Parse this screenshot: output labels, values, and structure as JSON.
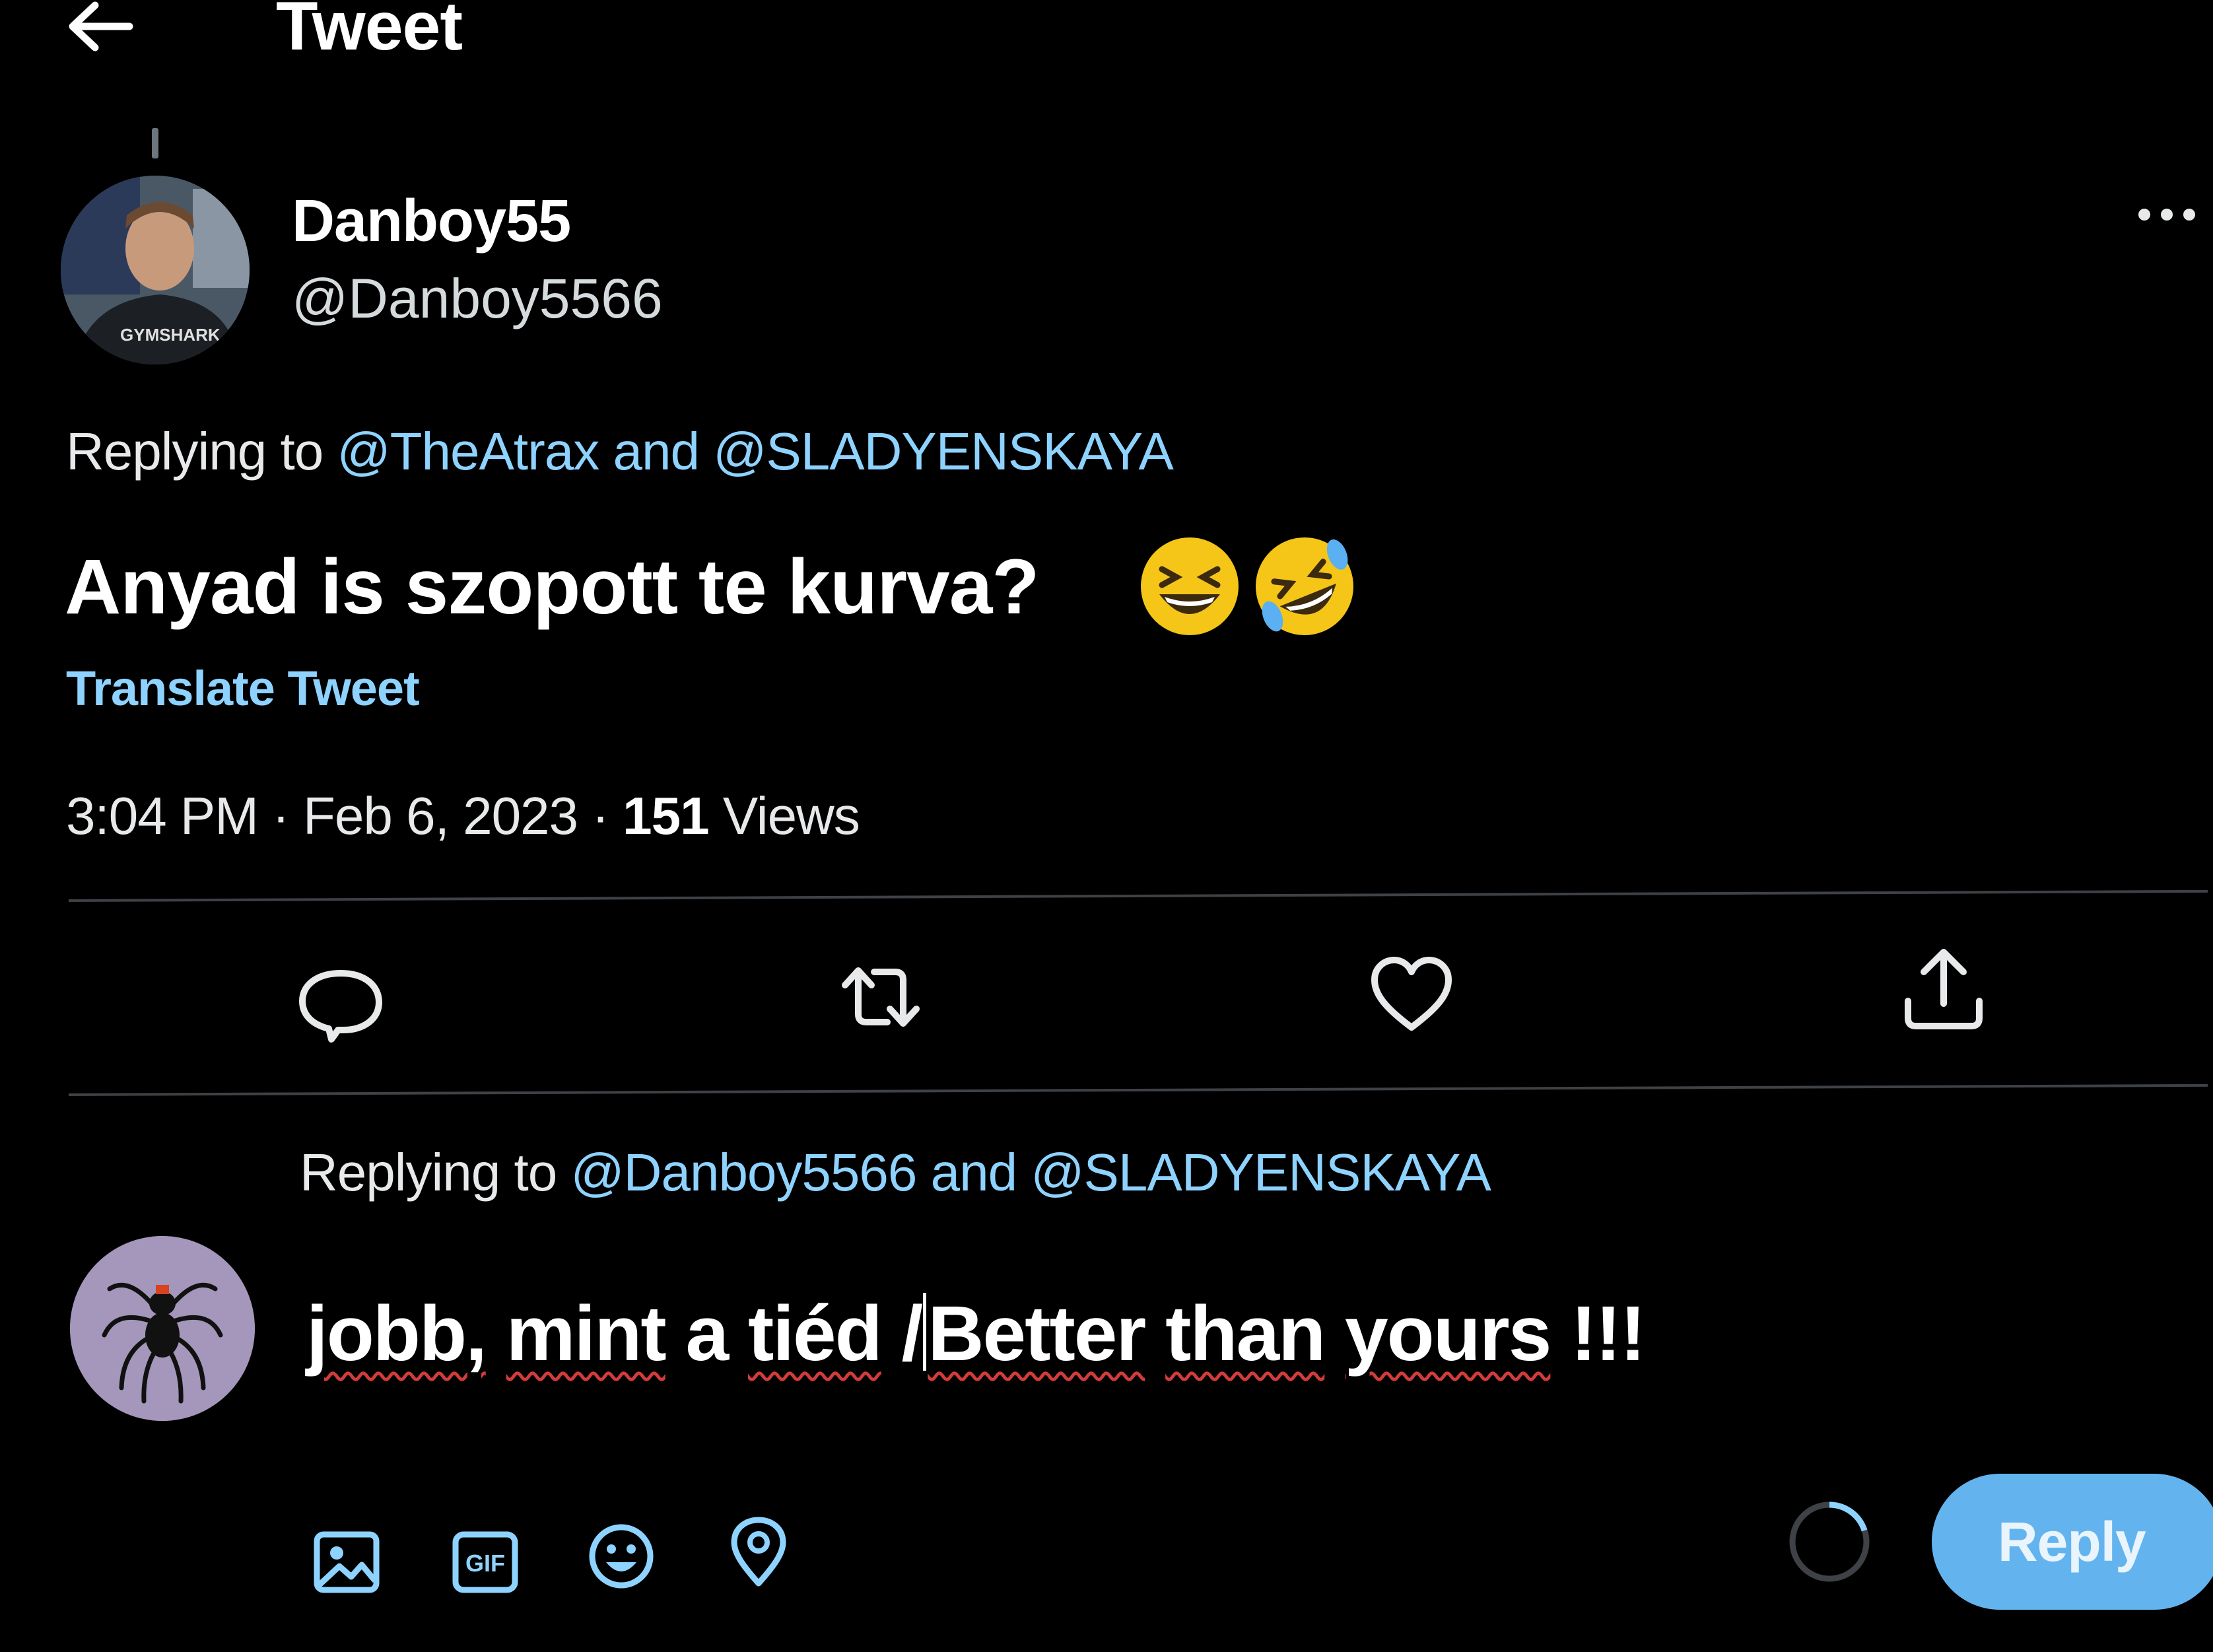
{
  "header": {
    "title": "Tweet",
    "back_icon": "back-arrow-icon"
  },
  "tweet": {
    "author_name": "Danboy55",
    "author_handle": "@Danboy5566",
    "avatar_shirt_text": "GYMSHARK",
    "replying_prefix": "Replying to",
    "replying_mention_1": "@TheAtrax",
    "replying_and": "and",
    "replying_mention_2": "@SLADYENSKAYA",
    "text": "Anyad is szopott te kurva?",
    "emojis": [
      "grinning-squinting-face",
      "rolling-on-floor-laughing"
    ],
    "translate_label": "Translate Tweet",
    "time": "3:04 PM",
    "date": "Feb 6, 2023",
    "view_count": "151",
    "views_label": "Views",
    "separator": "·"
  },
  "actions": [
    {
      "name": "reply-icon"
    },
    {
      "name": "retweet-icon"
    },
    {
      "name": "like-icon"
    },
    {
      "name": "share-icon"
    }
  ],
  "composer": {
    "replying_prefix": "Replying to",
    "replying_mention_1": "@Danboy5566",
    "replying_and": "and",
    "replying_mention_2": "@SLADYENSKAYA",
    "input_parts": {
      "w1": "jobb,",
      "w2": "mint",
      "w3": "a",
      "w4": "tiéd",
      "w5": "/",
      "w6": "Better",
      "w7": "than",
      "w8": "yours",
      "w9": "!!!"
    },
    "toolbar_icons": [
      "media-icon",
      "gif-icon",
      "emoji-icon",
      "location-icon"
    ],
    "gif_label": "GIF",
    "reply_button_label": "Reply"
  },
  "colors": {
    "background": "#000000",
    "link": "#8ed3ff",
    "reply_button": "#63b4ee",
    "divider": "#3e4246"
  }
}
